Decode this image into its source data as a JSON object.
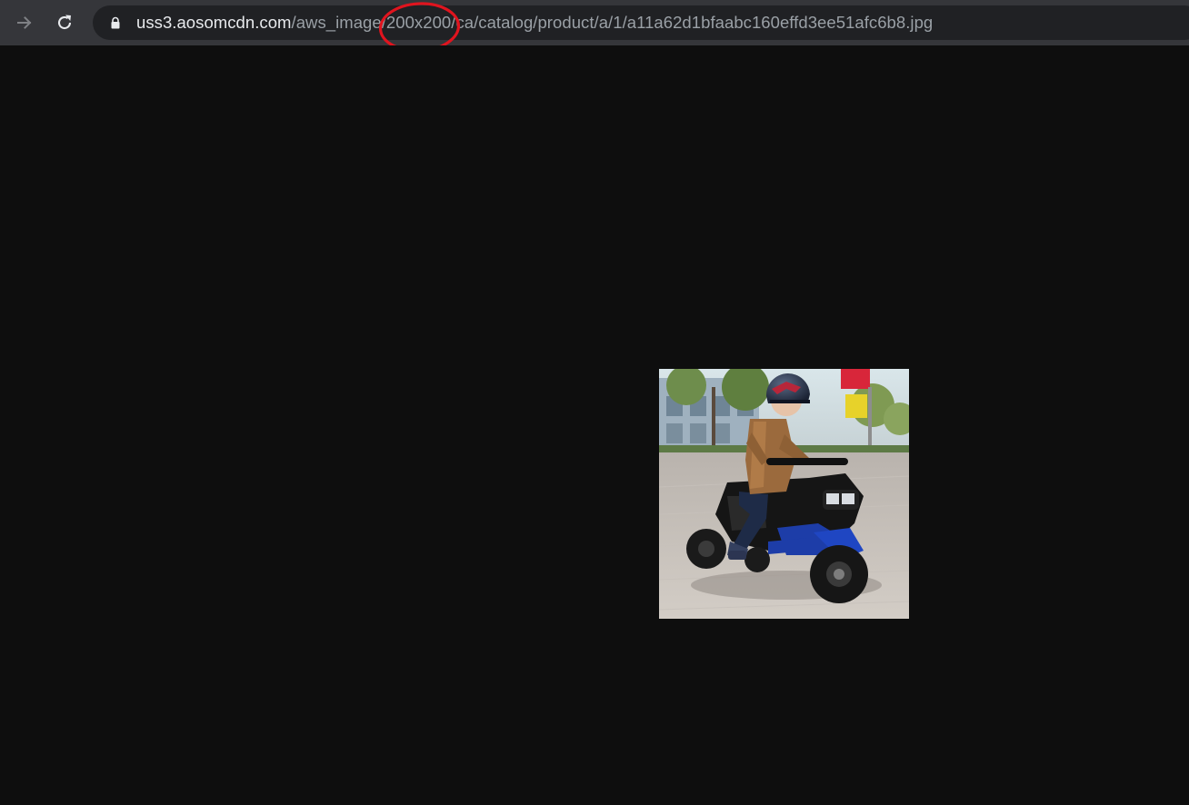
{
  "toolbar": {
    "forward_icon": "arrow-right-icon",
    "reload_icon": "reload-icon"
  },
  "address_bar": {
    "lock_icon": "lock-icon",
    "url_host": "uss3.aosomcdn.com",
    "url_path": "/aws_image/200x200/ca/catalog/product/a/1/a11a62d1bfaabc160effd3ee51afc6b8.jpg",
    "highlighted_segment": "200x200",
    "highlight_color": "#e0141e"
  },
  "page": {
    "background": "#0e0e0e",
    "image_subject": "child-on-blue-electric-motorcycle-photo"
  }
}
